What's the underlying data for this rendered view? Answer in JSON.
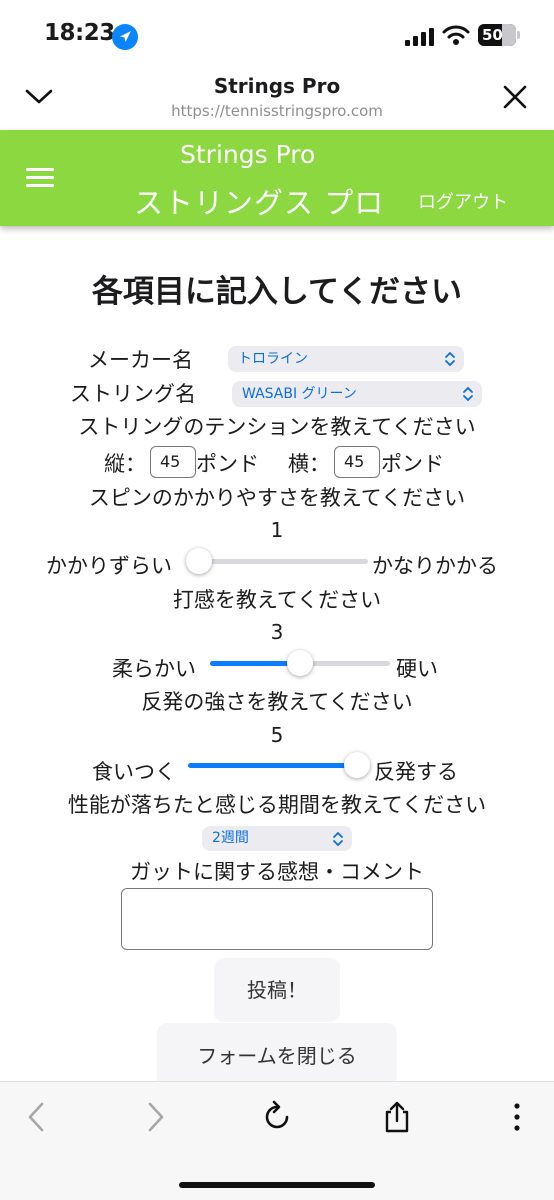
{
  "status_bar": {
    "time": "18:23",
    "battery": "50"
  },
  "browser": {
    "title": "Strings Pro",
    "url": "https://tennisstringspro.com"
  },
  "site_header": {
    "brand_en": "Strings Pro",
    "brand_ja": "ストリングス プロ",
    "logout": "ログアウト"
  },
  "form": {
    "title": "各項目に記入してください",
    "maker_label": "メーカー名",
    "maker_value": "トロライン",
    "string_label": "ストリング名",
    "string_value": "WASABI グリーン",
    "tension_question": "ストリングのテンションを教えてください",
    "main_label": "縦：",
    "main_value": "45",
    "pound_label_1": "ポンド",
    "cross_label": "横：",
    "cross_value": "45",
    "pound_label_2": "ポンド",
    "spin_question": "スピンのかかりやすさを教えてください",
    "spin_value": "1",
    "spin_min_label": "かかりずらい",
    "spin_max_label": "かなりかかる",
    "feel_question": "打感を教えてください",
    "feel_value": "3",
    "feel_min_label": "柔らかい",
    "feel_max_label": "硬い",
    "rebound_question": "反発の強さを教えてください",
    "rebound_value": "5",
    "rebound_min_label": "食いつく",
    "rebound_max_label": "反発する",
    "durability_question": "性能が落ちたと感じる期間を教えてください",
    "durability_value": "2週間",
    "comment_label": "ガットに関する感想・コメント",
    "submit_label": "投稿！",
    "close_label": "フォームを閉じる"
  },
  "sliders": {
    "min": 1,
    "max": 5,
    "spin": 1,
    "feel": 3,
    "rebound": 5
  },
  "colors": {
    "header_green": "#8bd841",
    "accent_blue": "#0a7cff"
  }
}
